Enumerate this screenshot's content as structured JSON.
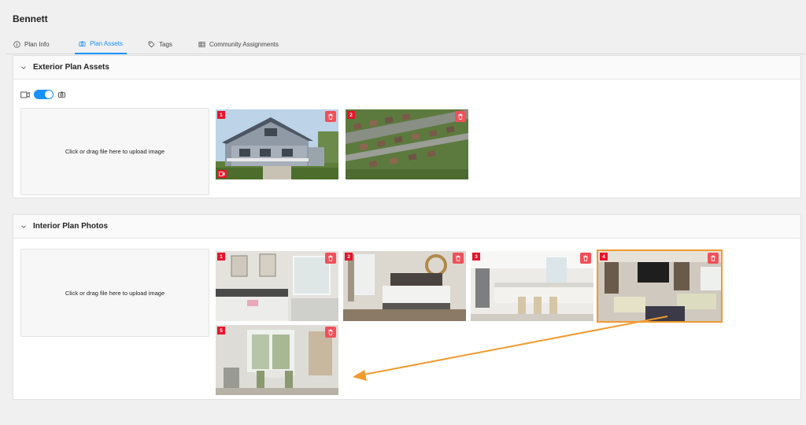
{
  "header": {
    "title": "Bennett"
  },
  "tabs": [
    {
      "label": "Plan Info",
      "icon": "info-icon",
      "active": false
    },
    {
      "label": "Plan Assets",
      "icon": "camera-icon",
      "active": true
    },
    {
      "label": "Tags",
      "icon": "tag-icon",
      "active": false
    },
    {
      "label": "Community Assignments",
      "icon": "grid-icon",
      "active": false
    }
  ],
  "exterior": {
    "title": "Exterior Plan Assets",
    "media_toggle": {
      "left_icon": "video-icon",
      "right_icon": "camera-icon",
      "on": true
    },
    "upload_label": "Click or drag file here to upload image",
    "images": [
      {
        "number": "1",
        "subject": "house exterior",
        "has_video": true
      },
      {
        "number": "2",
        "subject": "neighborhood aerial",
        "has_video": false
      }
    ]
  },
  "interior": {
    "title": "Interior Plan Photos",
    "upload_label": "Click or drag file here to upload image",
    "images": [
      {
        "number": "1",
        "subject": "bathroom",
        "selected": false
      },
      {
        "number": "2",
        "subject": "bedroom",
        "selected": false
      },
      {
        "number": "3",
        "subject": "kitchen",
        "selected": false
      },
      {
        "number": "4",
        "subject": "living room",
        "selected": true
      },
      {
        "number": "5",
        "subject": "dining room",
        "selected": false
      }
    ]
  },
  "colors": {
    "accent": "#1890ff",
    "badge": "#e8132b",
    "delete": "#f0505a",
    "highlight": "#f29a2e"
  }
}
